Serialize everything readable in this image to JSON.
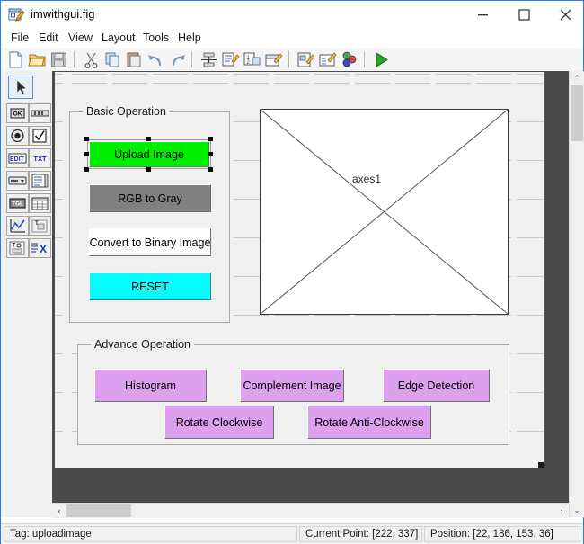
{
  "window": {
    "title": "imwithgui.fig",
    "icon": "guide-figure-icon",
    "minimize_label": "–",
    "maximize_label": "□",
    "close_label": "✕"
  },
  "menubar": {
    "items": [
      {
        "label": "File",
        "name": "menu-file"
      },
      {
        "label": "Edit",
        "name": "menu-edit"
      },
      {
        "label": "View",
        "name": "menu-view"
      },
      {
        "label": "Layout",
        "name": "menu-layout"
      },
      {
        "label": "Tools",
        "name": "menu-tools"
      },
      {
        "label": "Help",
        "name": "menu-help"
      }
    ]
  },
  "toolbar": {
    "buttons": [
      {
        "name": "new-figure-icon",
        "glyph": "new"
      },
      {
        "name": "open-figure-icon",
        "glyph": "open"
      },
      {
        "name": "save-figure-icon",
        "glyph": "save"
      },
      {
        "name": "cut-icon",
        "glyph": "cut"
      },
      {
        "name": "copy-icon",
        "glyph": "copy"
      },
      {
        "name": "paste-icon",
        "glyph": "paste"
      },
      {
        "name": "undo-icon",
        "glyph": "undo"
      },
      {
        "name": "redo-icon",
        "glyph": "redo"
      },
      {
        "name": "align-objects-icon",
        "glyph": "align"
      },
      {
        "name": "menu-editor-icon",
        "glyph": "menueditor"
      },
      {
        "name": "tab-order-editor-icon",
        "glyph": "taborder"
      },
      {
        "name": "toolbar-editor-icon",
        "glyph": "toolbareditor"
      },
      {
        "name": "m-file-editor-icon",
        "glyph": "mfileeditor"
      },
      {
        "name": "property-inspector-icon",
        "glyph": "inspector"
      },
      {
        "name": "object-browser-icon",
        "glyph": "objectbrowser"
      },
      {
        "name": "run-figure-icon",
        "glyph": "run"
      }
    ]
  },
  "palette": {
    "selected": "select-tool",
    "items": [
      {
        "name": "push-button-tool",
        "glyph": "OK"
      },
      {
        "name": "slider-tool",
        "glyph": "slider"
      },
      {
        "name": "radio-button-tool",
        "glyph": "radio"
      },
      {
        "name": "check-box-tool",
        "glyph": "check"
      },
      {
        "name": "edit-text-tool",
        "glyph": "EDIT"
      },
      {
        "name": "static-text-tool",
        "glyph": "TXT"
      },
      {
        "name": "pop-up-menu-tool",
        "glyph": "popup"
      },
      {
        "name": "list-box-tool",
        "glyph": "listbox"
      },
      {
        "name": "toggle-button-tool",
        "glyph": "TGL"
      },
      {
        "name": "table-tool",
        "glyph": "table"
      },
      {
        "name": "axes-tool",
        "glyph": "axes"
      },
      {
        "name": "panel-tool",
        "glyph": "panel"
      },
      {
        "name": "button-group-tool",
        "glyph": "buttongroup"
      },
      {
        "name": "activex-control-tool",
        "glyph": "ActiveX"
      }
    ]
  },
  "figure": {
    "basic_panel": {
      "title": "Basic Operation",
      "buttons": [
        {
          "label": "Upload Image",
          "name": "upload-image-button",
          "color": "#00ee00",
          "selected": true
        },
        {
          "label": "RGB to Gray",
          "name": "rgb-to-gray-button",
          "color": "#808080",
          "selected": false
        },
        {
          "label": "Convert to Binary Image",
          "name": "convert-to-binary-button",
          "color": "#ffffff",
          "selected": false
        },
        {
          "label": "RESET",
          "name": "reset-button",
          "color": "#00ffff",
          "selected": false
        }
      ]
    },
    "advance_panel": {
      "title": "Advance Operation",
      "buttons": [
        {
          "label": "Histogram",
          "name": "histogram-button",
          "color": "#dda0ee"
        },
        {
          "label": "Complement Image",
          "name": "complement-image-button",
          "color": "#dda0ee"
        },
        {
          "label": "Edge Detection",
          "name": "edge-detection-button",
          "color": "#dda0ee"
        },
        {
          "label": "Rotate Clockwise",
          "name": "rotate-clockwise-button",
          "color": "#dda0ee"
        },
        {
          "label": "Rotate Anti-Clockwise",
          "name": "rotate-anti-clockwise-button",
          "color": "#dda0ee"
        }
      ]
    },
    "axes": {
      "label": "axes1"
    }
  },
  "scrollbars": {
    "up_arrow": "⌃",
    "down_arrow": "⌄",
    "left_arrow": "‹",
    "right_arrow": "›"
  },
  "statusbar": {
    "tag": "Tag: uploadimage",
    "current_point": "Current Point:  [222, 337]",
    "position": "Position: [22, 186, 153, 36]"
  }
}
